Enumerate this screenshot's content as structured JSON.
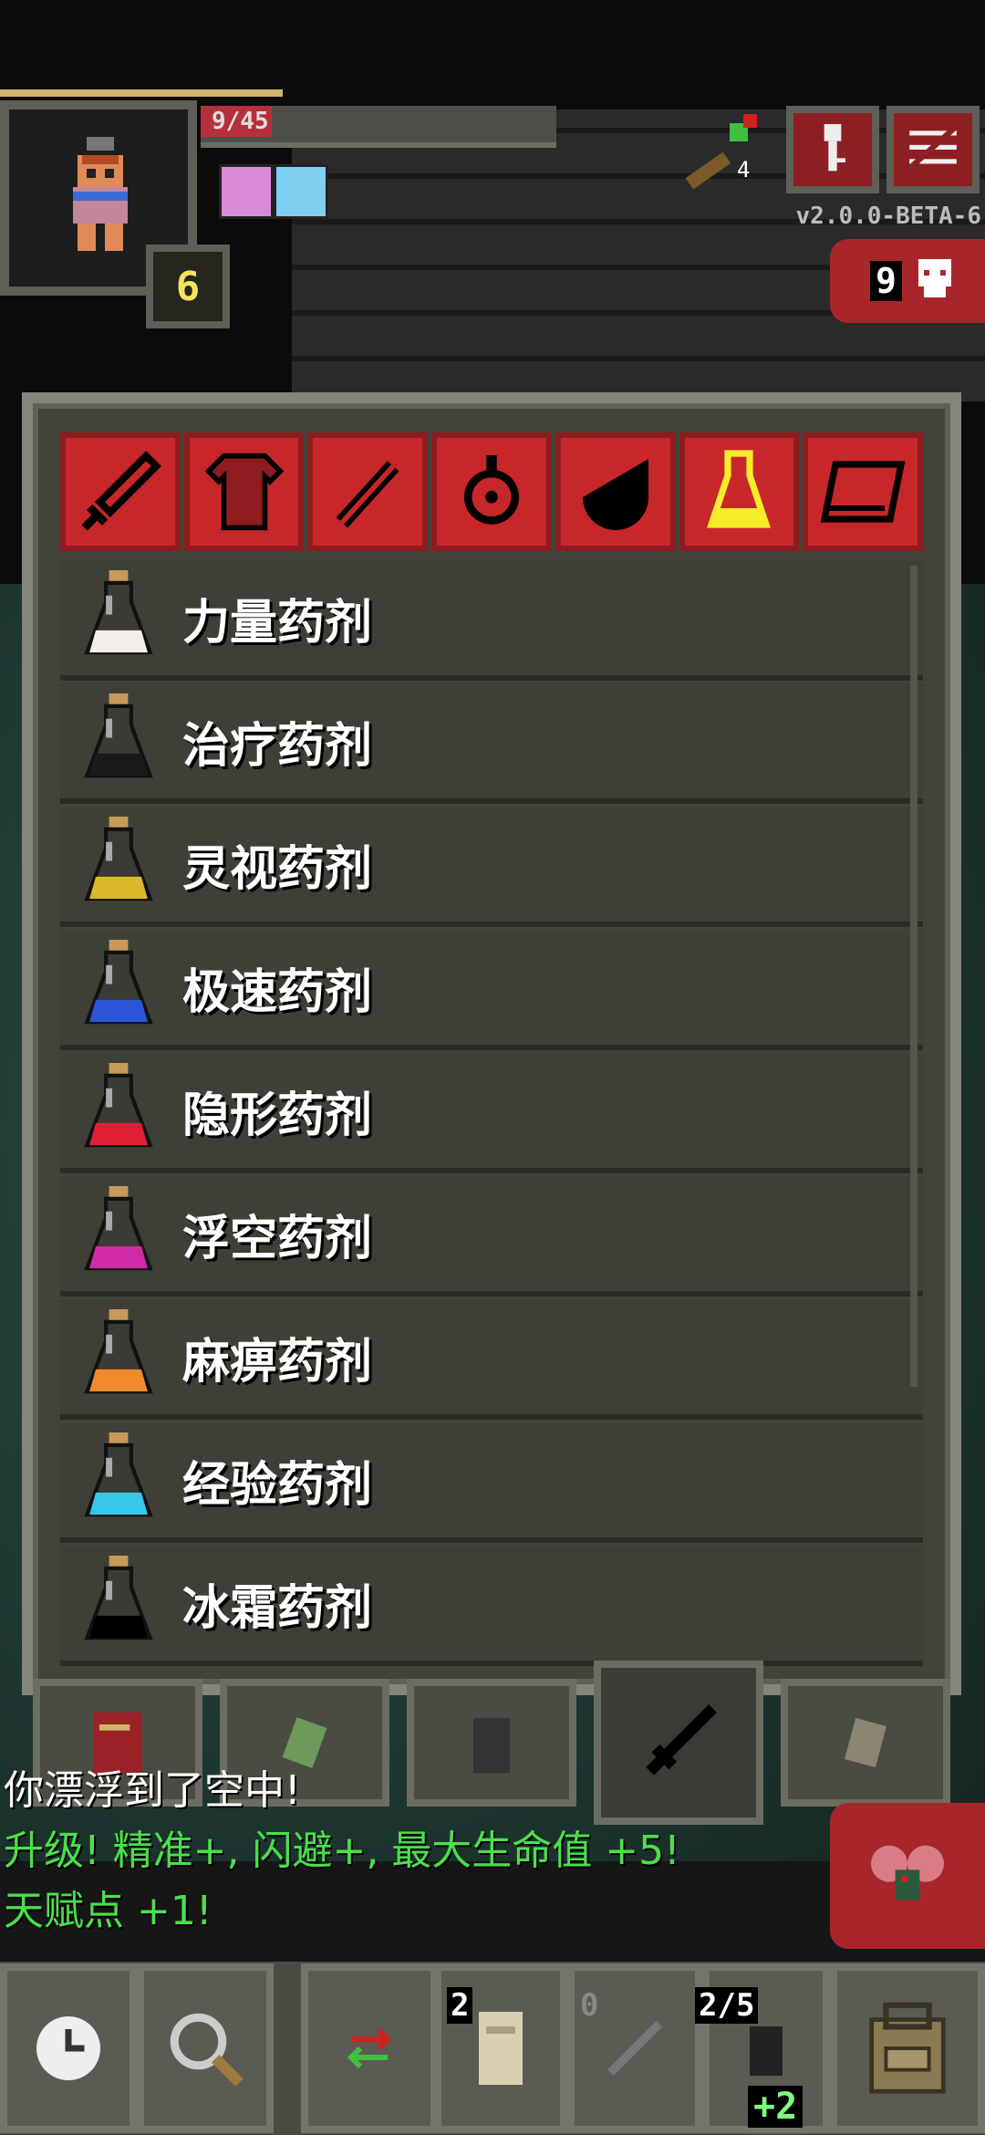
{
  "status": {
    "hp_text": "9/45",
    "hp_fraction": 0.2,
    "level": "6",
    "quick_weapon_count": "4",
    "version": "v2.0.0-BETA-6",
    "danger_count": "9"
  },
  "catalog": {
    "tabs": [
      {
        "icon": "sword-icon",
        "active": false
      },
      {
        "icon": "armor-icon",
        "active": false
      },
      {
        "icon": "wand-icon",
        "active": false
      },
      {
        "icon": "ring-icon",
        "active": false
      },
      {
        "icon": "artifact-icon",
        "active": false
      },
      {
        "icon": "potion-icon",
        "active": true
      },
      {
        "icon": "scroll-icon",
        "active": false
      }
    ],
    "items": [
      {
        "label": "力量药剂",
        "color": "#f2efe6"
      },
      {
        "label": "治疗药剂",
        "color": "#1a1a1a"
      },
      {
        "label": "灵视药剂",
        "color": "#d8b92a"
      },
      {
        "label": "极速药剂",
        "color": "#2a55d6"
      },
      {
        "label": "隐形药剂",
        "color": "#e02035"
      },
      {
        "label": "浮空药剂",
        "color": "#d12aa8"
      },
      {
        "label": "麻痹药剂",
        "color": "#f08a2a"
      },
      {
        "label": "经验药剂",
        "color": "#35c8e8"
      },
      {
        "label": "冰霜药剂",
        "color": "#000000"
      }
    ]
  },
  "log": {
    "line1": "你漂浮到了空中!",
    "line2": "升级! 精准+, 闪避+, 最大生命值 +5!",
    "line3": "天赋点 +1!"
  },
  "toolbar": {
    "slot1_count": "2",
    "slot2_count": "0",
    "slot3_count": "2/5",
    "slot3_bonus": "+2"
  }
}
